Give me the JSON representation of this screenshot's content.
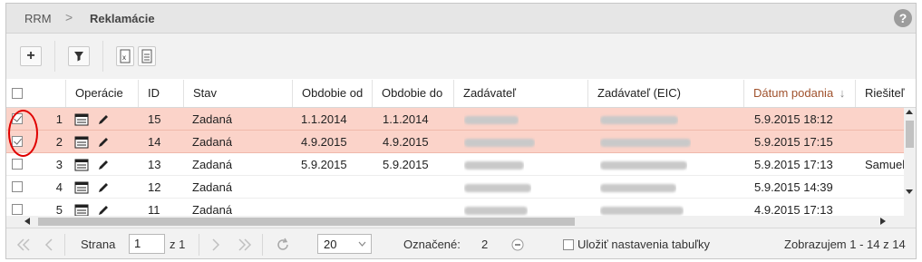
{
  "breadcrumb": {
    "root": "RRM",
    "separator": ">",
    "current": "Reklamácie"
  },
  "help_symbol": "?",
  "toolbar": {
    "add_symbol": "+",
    "buttons": [
      "plus-icon",
      "filter-icon",
      "excel-export-icon",
      "document-export-icon"
    ]
  },
  "columns": {
    "operacie": "Operácie",
    "id": "ID",
    "stav": "Stav",
    "obdobie_od": "Obdobie od",
    "obdobie_do": "Obdobie do",
    "zadavatel": "Zadávateľ",
    "zadavatel_eic": "Zadávateľ (EIC)",
    "datum_podania": "Dátum podania",
    "riesitel": "Riešiteľ",
    "sort_arrow": "↓"
  },
  "rows": [
    {
      "num": "1",
      "id": "15",
      "stav": "Zadaná",
      "od": "1.1.2014",
      "do": "1.1.2014",
      "datum": "5.9.2015 18:12",
      "riesitel": "",
      "selected": true
    },
    {
      "num": "2",
      "id": "14",
      "stav": "Zadaná",
      "od": "4.9.2015",
      "do": "4.9.2015",
      "datum": "5.9.2015 17:15",
      "riesitel": "",
      "selected": true
    },
    {
      "num": "3",
      "id": "13",
      "stav": "Zadaná",
      "od": "5.9.2015",
      "do": "5.9.2015",
      "datum": "5.9.2015 17:13",
      "riesitel": "Samuel",
      "selected": false
    },
    {
      "num": "4",
      "id": "12",
      "stav": "Zadaná",
      "od": "",
      "do": "",
      "datum": "5.9.2015 14:39",
      "riesitel": "",
      "selected": false
    },
    {
      "num": "5",
      "id": "11",
      "stav": "Zadaná",
      "od": "",
      "do": "",
      "datum": "4.9.2015 17:13",
      "riesitel": "",
      "selected": false
    }
  ],
  "pager": {
    "page_label": "Strana",
    "page_value": "1",
    "of_label": "z 1",
    "page_size": "20",
    "marked_label": "Označené:",
    "marked_count": "2",
    "save_settings_label": "Uložiť nastavenia tabuľky",
    "display_info": "Zobrazujem 1 - 14 z 14"
  },
  "colors": {
    "selected_row": "#fbd3c9",
    "sorted_header": "#a0522d",
    "annotation_circle": "#e00000"
  }
}
